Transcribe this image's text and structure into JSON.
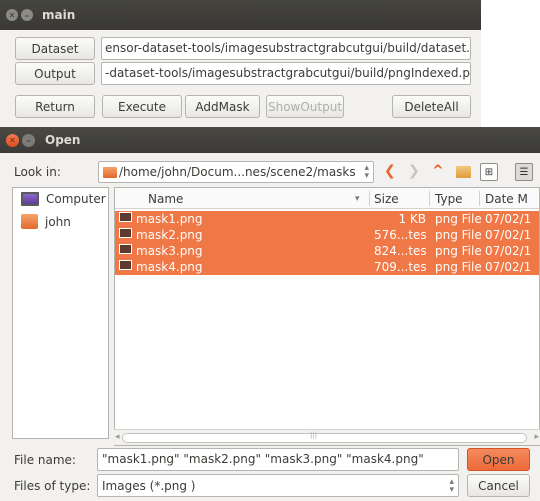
{
  "main_window": {
    "title": "main",
    "dataset_button": "Dataset",
    "dataset_path": "ensor-dataset-tools/imagesubstractgrabcutgui/build/dataset.csv",
    "output_button": "Output",
    "output_path": "-dataset-tools/imagesubstractgrabcutgui/build/pngIndexed.png",
    "return_button": "Return",
    "execute_button": "Execute",
    "addmask_button": "AddMask",
    "showoutput_button": "ShowOutput",
    "deleteall_button": "DeleteAll"
  },
  "dialog": {
    "title": "Open",
    "look_in_label": "Look in:",
    "look_in_path": "/home/john/Docum...nes/scene2/masks",
    "sidebar": [
      {
        "label": "Computer",
        "icon": "computer-icon"
      },
      {
        "label": "john",
        "icon": "home-folder-icon"
      }
    ],
    "columns": {
      "name": "Name",
      "size": "Size",
      "type": "Type",
      "date": "Date M"
    },
    "files": [
      {
        "name": "mask1.png",
        "size": "1 KB",
        "type": "png File",
        "date": "07/02/1"
      },
      {
        "name": "mask2.png",
        "size": "576...tes",
        "type": "png File",
        "date": "07/02/1"
      },
      {
        "name": "mask3.png",
        "size": "824...tes",
        "type": "png File",
        "date": "07/02/1"
      },
      {
        "name": "mask4.png",
        "size": "709...tes",
        "type": "png File",
        "date": "07/02/1"
      }
    ],
    "filename_label": "File name:",
    "filename_value": "\"mask1.png\" \"mask2.png\" \"mask3.png\" \"mask4.png\"",
    "filetype_label": "Files of type:",
    "filetype_value": "Images (*.png )",
    "open_button": "Open",
    "cancel_button": "Cancel",
    "accent_color": "#f07746"
  }
}
